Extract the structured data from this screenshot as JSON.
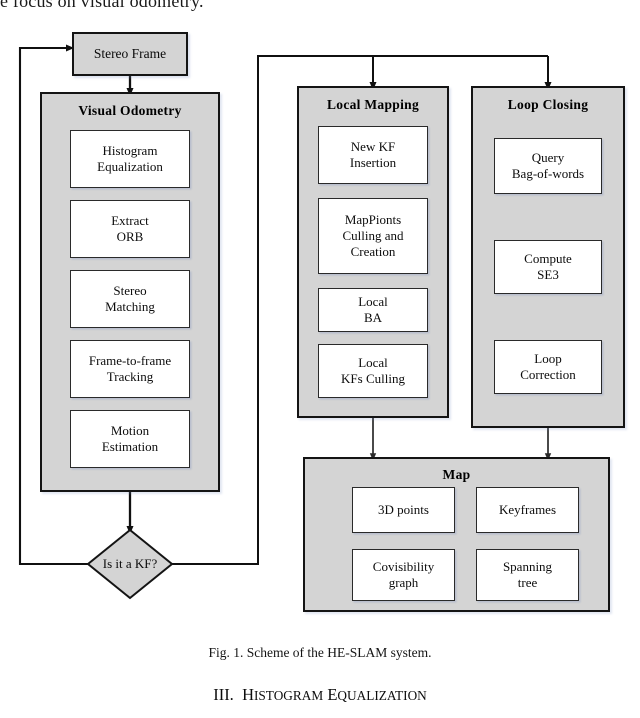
{
  "page": {
    "top_text_fragment": "e focus on visual odometry.",
    "figure_caption": "Fig. 1. Scheme of the HE-SLAM system.",
    "section_number": "III.",
    "section_title_first": "H",
    "section_title_rest": "ISTOGRAM",
    "section_title_second_first": "E",
    "section_title_second_rest": "QUALIZATION"
  },
  "colors": {
    "panel_fill": "#d4d4d4",
    "box_fill": "#ffffff",
    "stroke": "#141414",
    "text": "#0c0c0c",
    "page_background": "#ffffff"
  },
  "diagram": {
    "entry_node": {
      "label": "Stereo Frame"
    },
    "decision": {
      "label": "Is it a KF?"
    },
    "groups": [
      {
        "id": "visual-odometry",
        "title": "Visual Odometry",
        "steps": [
          {
            "id": "histogram-equalization",
            "label": "Histogram\nEqualization"
          },
          {
            "id": "extract-orb",
            "label": "Extract\nORB"
          },
          {
            "id": "stereo-matching",
            "label": "Stereo\nMatching"
          },
          {
            "id": "frame-to-frame-tracking",
            "label": "Frame-to-frame\nTracking"
          },
          {
            "id": "motion-estimation",
            "label": "Motion\nEstimation"
          }
        ]
      },
      {
        "id": "local-mapping",
        "title": "Local Mapping",
        "steps": [
          {
            "id": "new-kf-insertion",
            "label": "New KF\nInsertion"
          },
          {
            "id": "mappoints-culling-and-creation",
            "label": "MapPionts\nCulling and\nCreation"
          },
          {
            "id": "local-ba",
            "label": "Local\nBA"
          },
          {
            "id": "local-kfs-culling",
            "label": "Local\nKFs Culling"
          }
        ]
      },
      {
        "id": "loop-closing",
        "title": "Loop Closing",
        "steps": [
          {
            "id": "query-bag-of-words",
            "label": "Query\nBag-of-words"
          },
          {
            "id": "compute-se3",
            "label": "Compute\nSE3"
          },
          {
            "id": "loop-correction",
            "label": "Loop\nCorrection"
          }
        ]
      },
      {
        "id": "map",
        "title": "Map",
        "steps": [
          {
            "id": "3d-points",
            "label": "3D points"
          },
          {
            "id": "keyframes",
            "label": "Keyframes"
          },
          {
            "id": "covisibility-graph",
            "label": "Covisibility\ngraph"
          },
          {
            "id": "spanning-tree",
            "label": "Spanning\ntree"
          }
        ]
      }
    ]
  }
}
